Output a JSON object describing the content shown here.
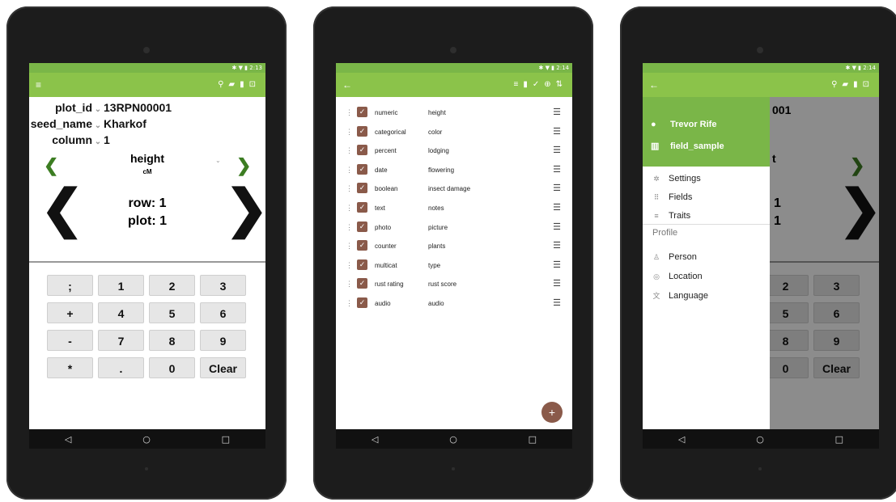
{
  "status_bar": {
    "time1": "2:13",
    "time2": "2:14",
    "time3": "2:14"
  },
  "nav": {
    "back": "◁",
    "home": "○",
    "recent": "□"
  },
  "screen1": {
    "plot_id_label": "plot_id",
    "plot_id_value": "13RPN00001",
    "seed_name_label": "seed_name",
    "seed_name_value": "Kharkof",
    "column_label": "column",
    "column_value": "1",
    "trait_name": "height",
    "trait_unit": "cM",
    "row_text": "row: 1",
    "plot_text": "plot: 1",
    "keypad": [
      ";",
      "1",
      "2",
      "3",
      "+",
      "4",
      "5",
      "6",
      "-",
      "7",
      "8",
      "9",
      "*",
      ".",
      "0",
      "Clear"
    ]
  },
  "screen2": {
    "traits": [
      {
        "format": "numeric",
        "name": "height"
      },
      {
        "format": "categorical",
        "name": "color"
      },
      {
        "format": "percent",
        "name": "lodging"
      },
      {
        "format": "date",
        "name": "flowering"
      },
      {
        "format": "boolean",
        "name": "insect damage"
      },
      {
        "format": "text",
        "name": "notes"
      },
      {
        "format": "photo",
        "name": "picture"
      },
      {
        "format": "counter",
        "name": "plants"
      },
      {
        "format": "multicat",
        "name": "type"
      },
      {
        "format": "rust rating",
        "name": "rust score"
      },
      {
        "format": "audio",
        "name": "audio"
      }
    ]
  },
  "screen3": {
    "user_name": "Trevor Rife",
    "field_name": "field_sample",
    "items": [
      "Settings",
      "Fields",
      "Traits"
    ],
    "profile_header": "Profile",
    "profile_items": [
      "Person",
      "Location",
      "Language"
    ],
    "bg_plot_fragment": "001",
    "bg_row_fragment": "1",
    "bg_plot_val_fragment": "1",
    "bg_trait_fragment": "t",
    "bg_keypad": [
      "2",
      "3",
      "5",
      "6",
      "8",
      "9",
      "0",
      "Clear"
    ]
  },
  "colors": {
    "statusbar": "#7ab648",
    "appbar": "#8bc34a",
    "accent": "#3c7d22",
    "checkbox": "#8a5a4a"
  }
}
